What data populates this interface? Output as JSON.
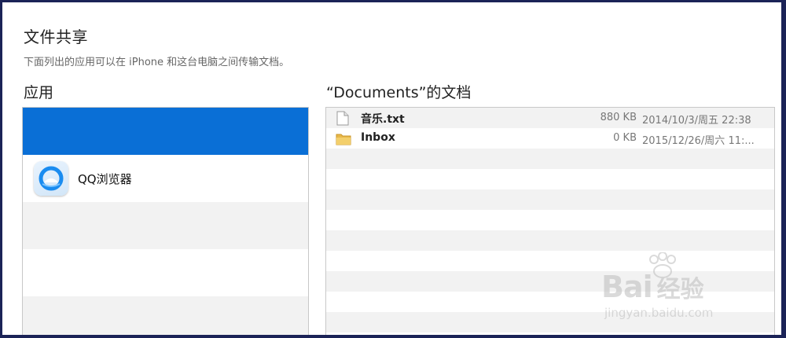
{
  "header": {
    "title": "文件共享",
    "subtitle": "下面列出的应用可以在 iPhone 和这台电脑之间传输文档。"
  },
  "apps": {
    "heading": "应用",
    "items": [
      {
        "label": "",
        "selected": true
      },
      {
        "label": "QQ浏览器",
        "icon": "qq-browser-icon"
      }
    ]
  },
  "documents": {
    "heading": "“Documents”的文档",
    "files": [
      {
        "name": "音乐.txt",
        "size": "880 KB",
        "date": "2014/10/3/周五 22:38",
        "icon": "text-file-icon"
      },
      {
        "name": "Inbox",
        "size": "0 KB",
        "date": "2015/12/26/周六 11:...",
        "icon": "folder-icon"
      }
    ]
  },
  "watermark": {
    "logo": "Bai",
    "logo_cn": "经验",
    "url": "jingyan.baidu.com"
  },
  "colors": {
    "selection": "#0a6fd6",
    "frame": "#1b2357",
    "stripe": "#f2f2f2"
  }
}
